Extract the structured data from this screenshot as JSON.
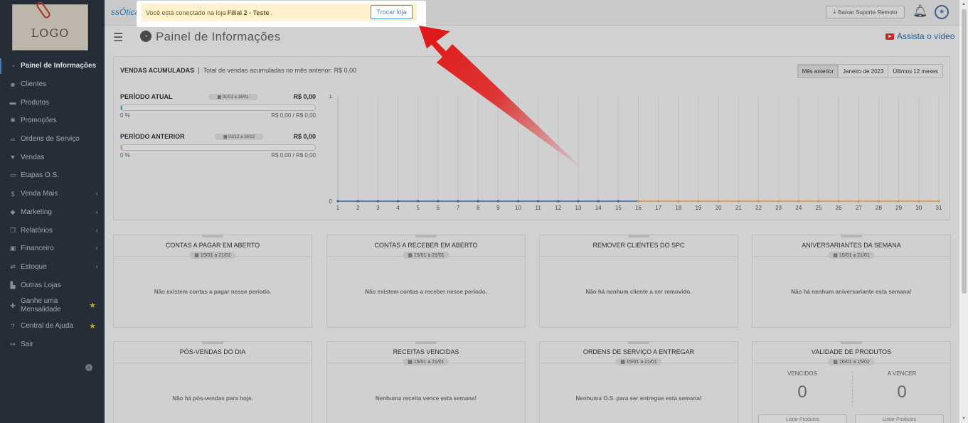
{
  "sidebar": {
    "logo": "LOGO",
    "items": [
      {
        "icon": "dashboard-icon",
        "glyph": "◔",
        "label": "Painel de Informações",
        "active": true
      },
      {
        "icon": "users-icon",
        "glyph": "☻",
        "label": "Clientes"
      },
      {
        "icon": "cart-icon",
        "glyph": "▬",
        "label": "Produtos"
      },
      {
        "icon": "asterisk-icon",
        "glyph": "✱",
        "label": "Promoções"
      },
      {
        "icon": "glasses-icon",
        "glyph": "∞",
        "label": "Ordens de Serviço"
      },
      {
        "icon": "basket-icon",
        "glyph": "▼",
        "label": "Vendas"
      },
      {
        "icon": "card-icon",
        "glyph": "▭",
        "label": "Etapas O.S."
      },
      {
        "icon": "dollar-icon",
        "glyph": "$",
        "label": "Venda Mais",
        "chevron": true
      },
      {
        "icon": "comments-icon",
        "glyph": "◆",
        "label": "Marketing",
        "chevron": true
      },
      {
        "icon": "copy-icon",
        "glyph": "❐",
        "label": "Relatórios",
        "chevron": true
      },
      {
        "icon": "money-icon",
        "glyph": "▣",
        "label": "Financeiro",
        "chevron": true
      },
      {
        "icon": "exchange-icon",
        "glyph": "⇄",
        "label": "Estoque",
        "chevron": true
      },
      {
        "icon": "building-icon",
        "glyph": "▙",
        "label": "Outras Lojas"
      },
      {
        "icon": "gift-icon",
        "glyph": "✚",
        "label": "Ganhe uma Mensalidade",
        "star": true
      },
      {
        "icon": "help-icon",
        "glyph": "?",
        "label": "Central de Ajuda",
        "star": true
      },
      {
        "icon": "sign-out-icon",
        "glyph": "↦",
        "label": "Sair"
      }
    ]
  },
  "topbar": {
    "brand": "ssÓtica",
    "download_label": "Baixar Suporte Remoto"
  },
  "notice": {
    "prefix": "Você está conectado na loja",
    "store": "Filial 2 - Teste",
    "suffix": ".",
    "button": "Trocar loja"
  },
  "header": {
    "title": "Painel de Informações",
    "video_link": "Assista o vídeo"
  },
  "sales": {
    "title": "VENDAS ACUMULADAS",
    "subtitle": "Total de vendas acumuladas no mês anterior: R$ 0,00",
    "tabs": [
      "Mês anterior",
      "Janeiro de 2023",
      "Últimos 12 meses"
    ],
    "current": {
      "label": "PERÍODO ATUAL",
      "dates": "01/01 a 16/01",
      "value": "R$ 0,00",
      "percent_text": "0 %",
      "range": "R$ 0,00 / R$ 0,00",
      "percent": 0,
      "color": "#4a90d9"
    },
    "previous": {
      "label": "PERÍODO ANTERIOR",
      "dates": "01/12 a 16/12",
      "value": "R$ 0,00",
      "percent_text": "0 %",
      "range": "R$ 0,00 / R$ 0,00",
      "percent": 0,
      "color": "#f0ad4e"
    }
  },
  "chart_data": {
    "type": "line",
    "x": [
      1,
      2,
      3,
      4,
      5,
      6,
      7,
      8,
      9,
      10,
      11,
      12,
      13,
      14,
      15,
      16,
      17,
      18,
      19,
      20,
      21,
      22,
      23,
      24,
      25,
      26,
      27,
      28,
      29,
      30,
      31
    ],
    "series": [
      {
        "values": [
          0,
          0,
          0,
          0,
          0,
          0,
          0,
          0,
          0,
          0,
          0,
          0,
          0,
          0,
          0,
          0
        ],
        "x_start": 1,
        "color": "#3b6ea5"
      },
      {
        "values": [
          0,
          0,
          0,
          0,
          0,
          0,
          0,
          0,
          0,
          0,
          0,
          0,
          0,
          0,
          0,
          0
        ],
        "x_start": 16,
        "color": "#f0ad4e"
      }
    ],
    "ylim": [
      0,
      1
    ],
    "yticks": [
      "0",
      "1"
    ],
    "grid": true
  },
  "cards_row1": [
    {
      "title": "CONTAS A PAGAR EM ABERTO",
      "date": "15/01 a 21/01",
      "message": "Não existem contas a pagar nesse período."
    },
    {
      "title": "CONTAS A RECEBER EM ABERTO",
      "date": "15/01 a 21/01",
      "message": "Não existem contas a receber nesse período."
    },
    {
      "title": "REMOVER CLIENTES DO SPC",
      "date": "",
      "message": "Não há nenhum cliente a ser removido."
    },
    {
      "title": "ANIVERSARIANTES DA SEMANA",
      "date": "15/01 a 21/01",
      "message": "Não há nenhum aniversariante esta semana!"
    }
  ],
  "cards_row2": [
    {
      "title": "PÓS-VENDAS DO DIA",
      "date": "",
      "message": "Não há pós-vendas para hoje."
    },
    {
      "title": "RECEITAS VENCIDAS",
      "date": "15/01 a 21/01",
      "message": "Nenhuma receita vence esta semana!"
    },
    {
      "title": "ORDENS DE SERVIÇO A ENTREGAR",
      "date": "15/01 a 21/01",
      "message": "Nenhuma O.S. para ser entregue esta semana!"
    }
  ],
  "validade": {
    "title": "VALIDADE DE PRODUTOS",
    "date": "16/01 a 15/02",
    "vencidos_label": "VENCIDOS",
    "vencidos_value": "0",
    "avencer_label": "A VENCER",
    "avencer_value": "0",
    "btn_label": "Listar Produtos"
  },
  "colors": {
    "sidebar": "#2b3541",
    "accent": "#3f8ed6",
    "arrow": "#e01a1a"
  }
}
